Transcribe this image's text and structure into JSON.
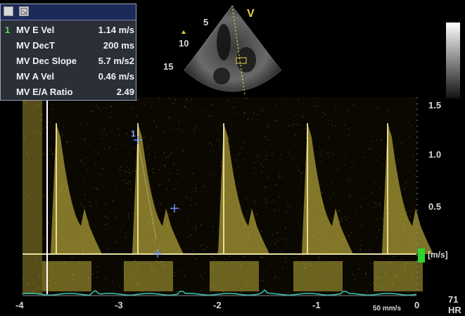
{
  "measurements": {
    "header_icon": "settings-icon",
    "active_index": "1",
    "rows": [
      {
        "label": "MV E Vel",
        "value": "1.14 m/s"
      },
      {
        "label": "MV DecT",
        "value": "200 ms"
      },
      {
        "label": "MV Dec Slope",
        "value": "5.7 m/s2"
      },
      {
        "label": "MV A Vel",
        "value": "0.46 m/s"
      },
      {
        "label": "MV E/A Ratio",
        "value": "2.49"
      }
    ]
  },
  "image_2d": {
    "depth_marks": [
      "5",
      "10",
      "15"
    ],
    "orientation_marker": "V"
  },
  "doppler": {
    "velocity_ticks": [
      "1.5",
      "1.0",
      "0.5"
    ],
    "velocity_unit": "[m/s]",
    "time_ticks": [
      "-4",
      "-3",
      "-2",
      "-1",
      "0"
    ],
    "sweep_speed": "50 mm/s",
    "heart_rate": "71",
    "heart_rate_label": "HR",
    "caliper_labels": [
      "1"
    ],
    "colors": {
      "spectrum": "#e6d24a",
      "baseline": "#e6e0a0",
      "ecg": "#35c9b4",
      "caliper": "#6f8fff"
    }
  }
}
